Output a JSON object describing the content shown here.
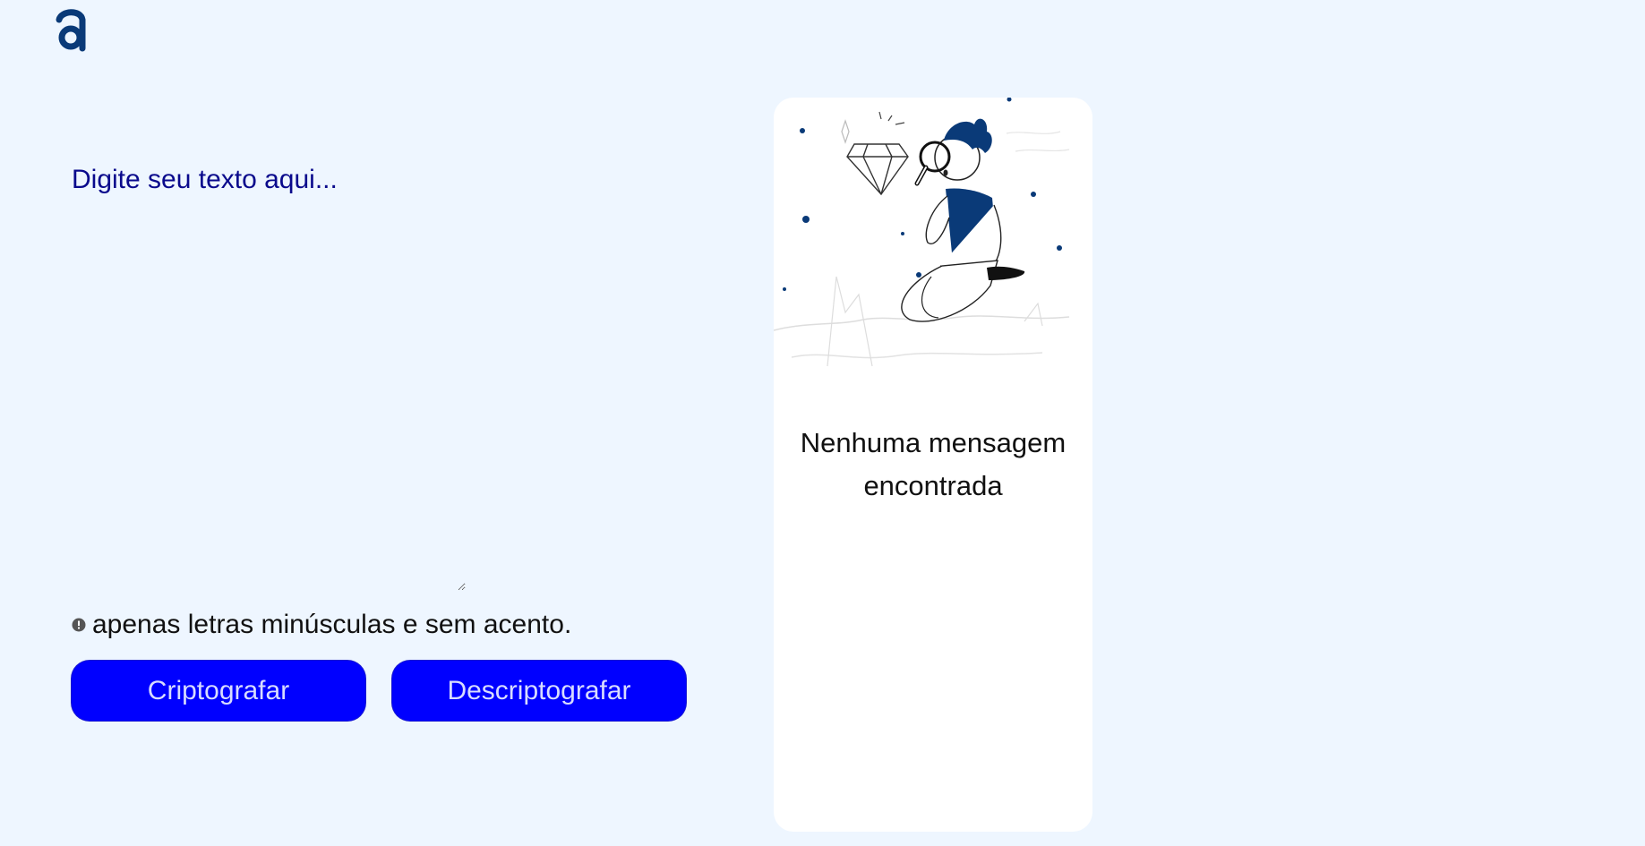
{
  "input": {
    "placeholder": "Digite seu texto aqui..."
  },
  "warning": {
    "icon": "exclamation-circle-icon",
    "text": "apenas letras minúsculas e sem acento."
  },
  "buttons": {
    "encrypt_label": "Criptografar",
    "decrypt_label": "Descriptografar"
  },
  "output": {
    "message": "Nenhuma mensagem encontrada"
  },
  "colors": {
    "background": "#eef6ff",
    "accent": "#0000ff",
    "brand": "#0a3a78",
    "text_primary": "#0a0a8c"
  }
}
